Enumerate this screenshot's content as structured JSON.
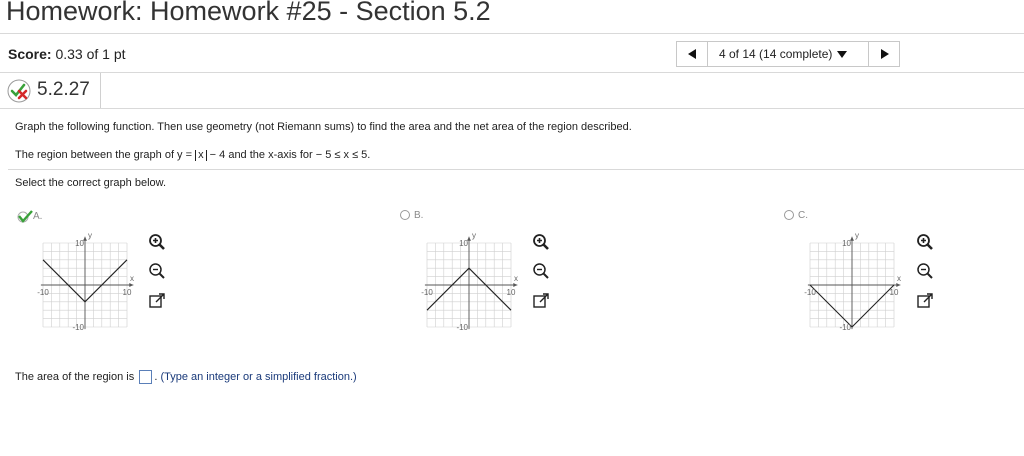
{
  "header": {
    "title": "Homework: Homework #25 - Section 5.2"
  },
  "score": {
    "label": "Score:",
    "value": "0.33 of 1 pt"
  },
  "nav": {
    "progress": "4 of 14 (14 complete)"
  },
  "question": {
    "number": "5.2.27"
  },
  "problem": {
    "instruction": "Graph the following function. Then use geometry (not Riemann sums) to find the area and the net area of the region described.",
    "region_prefix": "The region between the graph of y =",
    "abs_var": "x",
    "region_mid": "− 4 and the x-axis for",
    "domain": "− 5 ≤ x ≤ 5.",
    "select_prompt": "Select the correct graph below."
  },
  "options": [
    {
      "letter": "A.",
      "selected": true
    },
    {
      "letter": "B.",
      "selected": false
    },
    {
      "letter": "C.",
      "selected": false
    }
  ],
  "graph_labels": {
    "y": "y",
    "x": "x",
    "ymax": "10",
    "ymin": "-10",
    "xmin": "-10",
    "xmax": "10"
  },
  "answer": {
    "prefix": "The area of the region is",
    "value": "",
    "hint": "(Type an integer or a simplified fraction.)"
  },
  "colors": {
    "check": "#3aa13a",
    "wrong": "#d42a2a",
    "input_border": "#5a7fb8",
    "hint": "#1a3a7a"
  }
}
